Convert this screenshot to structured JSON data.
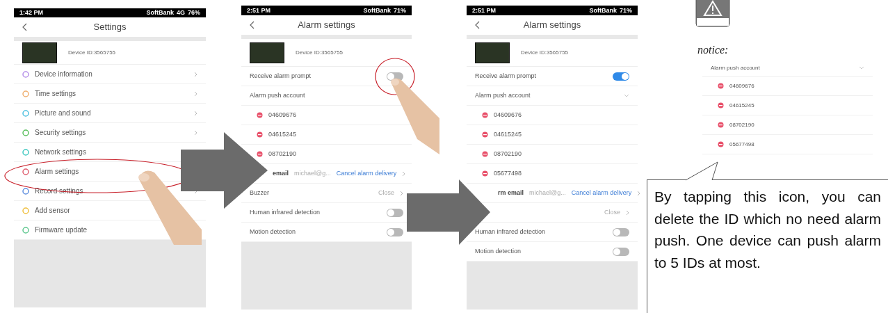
{
  "phones": [
    {
      "status": {
        "time": "1:42 PM",
        "carrier": "SoftBank",
        "network": "4G",
        "battery": "76%"
      },
      "title": "Settings",
      "device_id": "Device ID:3565755",
      "rows": [
        {
          "kind": "menu",
          "label": "Device information",
          "color": "#b48ee8",
          "chevron": true
        },
        {
          "kind": "menu",
          "label": "Time settings",
          "color": "#f0b070",
          "chevron": true
        },
        {
          "kind": "menu",
          "label": "Picture and sound",
          "color": "#4cc0e0",
          "chevron": true
        },
        {
          "kind": "menu",
          "label": "Security settings",
          "color": "#5cc060",
          "chevron": true
        },
        {
          "kind": "menu",
          "label": "Network settings",
          "color": "#40c8c0",
          "chevron": false
        },
        {
          "kind": "menu",
          "label": "Alarm settings",
          "color": "#e06070",
          "chevron": false
        },
        {
          "kind": "menu",
          "label": "Record settings",
          "color": "#6090e0",
          "chevron": true
        },
        {
          "kind": "menu",
          "label": "Add sensor",
          "color": "#f0c040",
          "chevron": false
        },
        {
          "kind": "menu",
          "label": "Firmware update",
          "color": "#60c890",
          "chevron": false
        }
      ]
    },
    {
      "status": {
        "time": "2:51 PM",
        "carrier": "SoftBank",
        "battery": "71%"
      },
      "title": "Alarm settings",
      "device_id": "Device ID:3565755",
      "rows": [
        {
          "kind": "toggle",
          "label": "Receive alarm prompt",
          "on": false
        },
        {
          "kind": "section",
          "label": "Alarm push account",
          "chevron": false
        },
        {
          "kind": "account",
          "label": "04609676"
        },
        {
          "kind": "account",
          "label": "04615245"
        },
        {
          "kind": "account",
          "label": "08702190"
        },
        {
          "kind": "email",
          "label": "email",
          "value": "michael@g...",
          "action": "Cancel alarm delivery"
        },
        {
          "kind": "value",
          "label": "Buzzer",
          "value": "Close"
        },
        {
          "kind": "toggle",
          "label": "Human infrared detection",
          "on": false
        },
        {
          "kind": "toggle",
          "label": "Motion detection",
          "on": false
        }
      ]
    },
    {
      "status": {
        "time": "2:51 PM",
        "carrier": "SoftBank",
        "battery": "71%"
      },
      "title": "Alarm settings",
      "device_id": "Device ID:3565755",
      "rows": [
        {
          "kind": "toggle",
          "label": "Receive alarm prompt",
          "on": true
        },
        {
          "kind": "section",
          "label": "Alarm push account",
          "chevron": true
        },
        {
          "kind": "account",
          "label": "04609676"
        },
        {
          "kind": "account",
          "label": "04615245"
        },
        {
          "kind": "account",
          "label": "08702190"
        },
        {
          "kind": "account",
          "label": "05677498"
        },
        {
          "kind": "email",
          "label": "rm email",
          "value": "michael@g...",
          "action": "Cancel alarm delivery"
        },
        {
          "kind": "value",
          "value": "Close"
        },
        {
          "kind": "toggle",
          "label": "Human infrared detection",
          "on": false
        },
        {
          "kind": "toggle",
          "label": "Motion detection",
          "on": false
        }
      ]
    }
  ],
  "notice": {
    "heading": "notice:",
    "list_title": "Alarm push account",
    "accounts": [
      "04609676",
      "04615245",
      "08702190",
      "05677498"
    ],
    "callout": "By tapping this icon, you can delete the ID which no need alarm push. One device can push alarm to 5 IDs at most."
  }
}
